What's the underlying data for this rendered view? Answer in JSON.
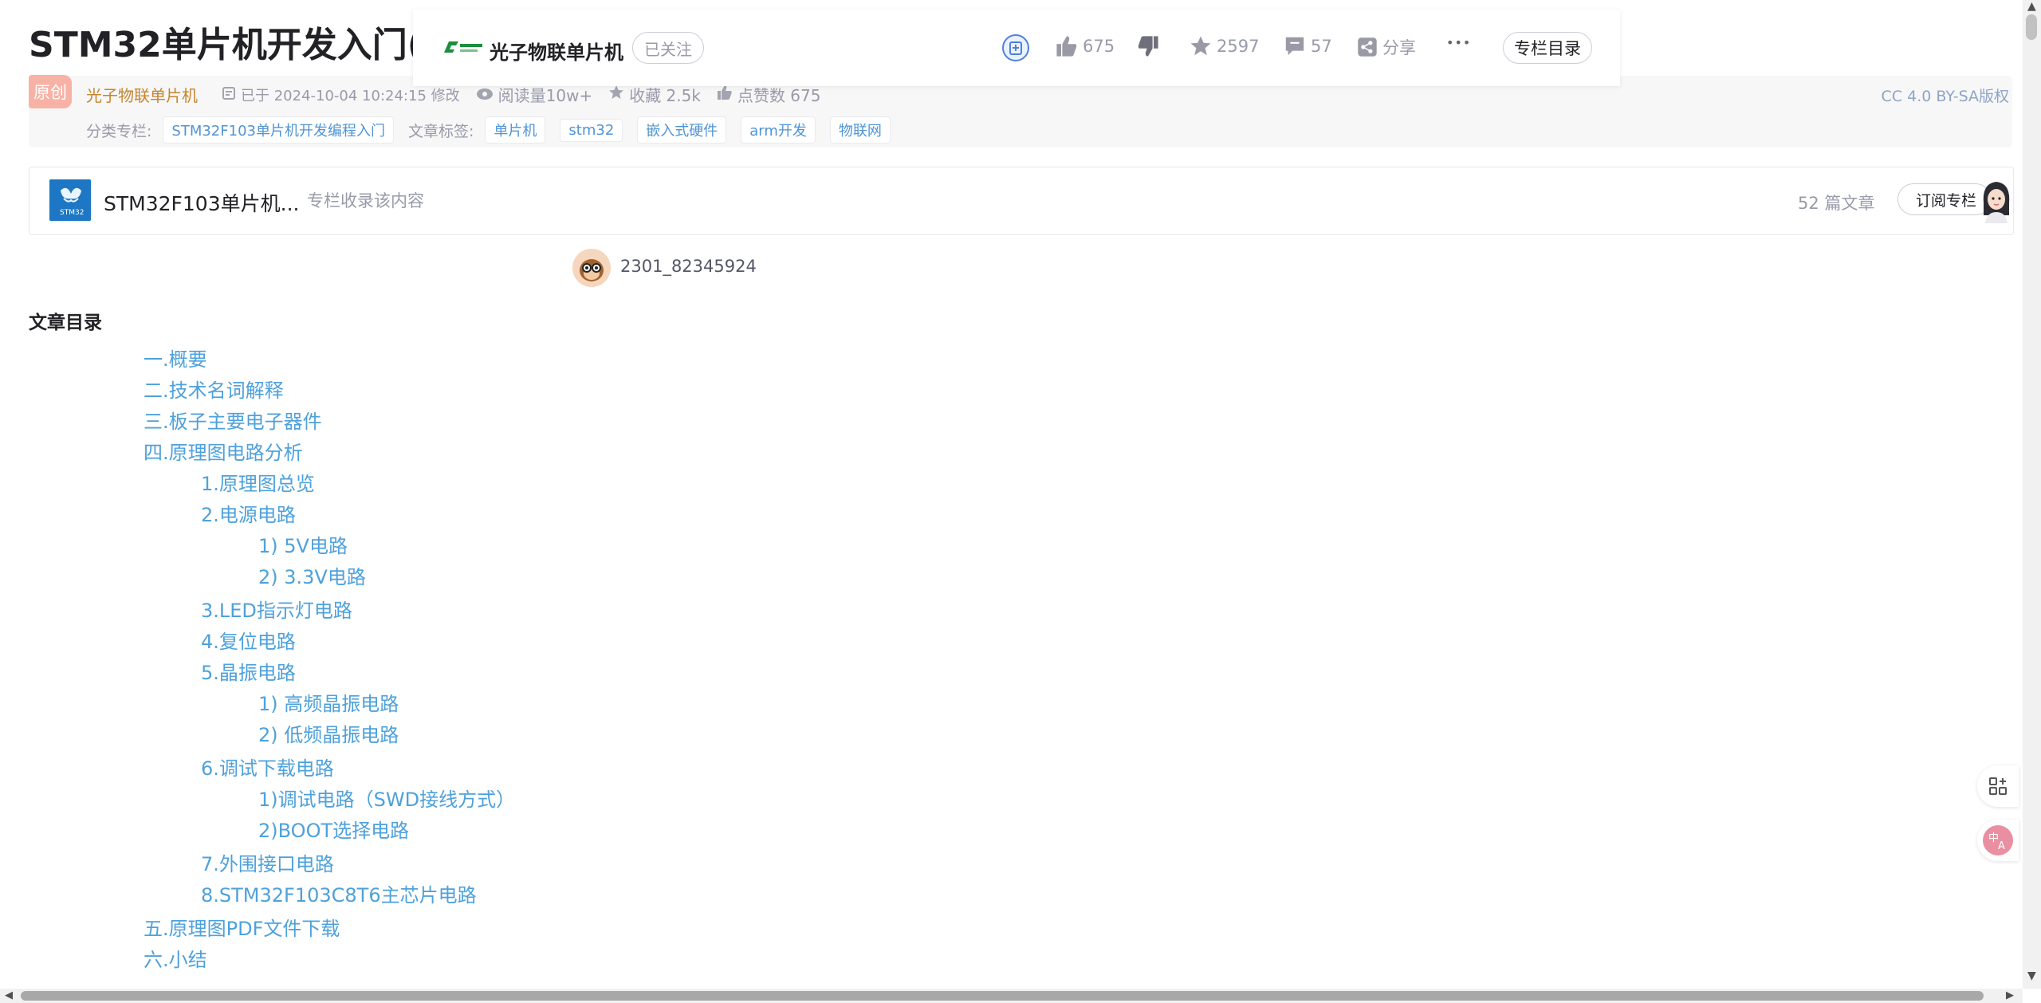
{
  "article": {
    "title": "STM32单片机开发入门(一",
    "badge": "原创",
    "author": "光子物联单片机",
    "modified": "已于 2024-10-04 10:24:15 修改",
    "views": "阅读量10w+",
    "favorites": "收藏 2.5k",
    "likes": "点赞数 675",
    "license": "CC 4.0 BY-SA版权",
    "category_label": "分类专栏:",
    "category": "STM32F103单片机开发编程入门",
    "tags_label": "文章标签:",
    "tags": [
      "单片机",
      "stm32",
      "嵌入式硬件",
      "arm开发",
      "物联网"
    ]
  },
  "column": {
    "name": "STM32F103单片机...",
    "subtitle": "专栏收录该内容",
    "count": "52 篇文章",
    "subscribe": "订阅专栏",
    "logo_text": "STM32"
  },
  "floatbar": {
    "author": "光子物联单片机",
    "follow": "已关注",
    "likes": "675",
    "favorites": "2597",
    "comments": "57",
    "share": "分享",
    "more": "•••",
    "catalog": "专栏目录"
  },
  "commenter": {
    "name": "2301_82345924"
  },
  "toc": {
    "title": "文章目录",
    "items": [
      "一.概要",
      "二.技术名词解释",
      "三.板子主要电子器件",
      "四.原理图电路分析",
      "1.原理图总览",
      "2.电源电路",
      "1) 5V电路",
      "2) 3.3V电路",
      "3.LED指示灯电路",
      "4.复位电路",
      "5.晶振电路",
      "1) 高频晶振电路",
      "2) 低频晶振电路",
      "6.调试下载电路",
      "1)调试电路（SWD接线方式）",
      "2)BOOT选择电路",
      "7.外围接口电路",
      "8.STM32F103C8T6主芯片电路",
      "五.原理图PDF文件下载",
      "六.小结"
    ]
  },
  "colors": {
    "link": "#4ea1db",
    "author": "#c6852f",
    "badge": "#f8b2a5"
  }
}
